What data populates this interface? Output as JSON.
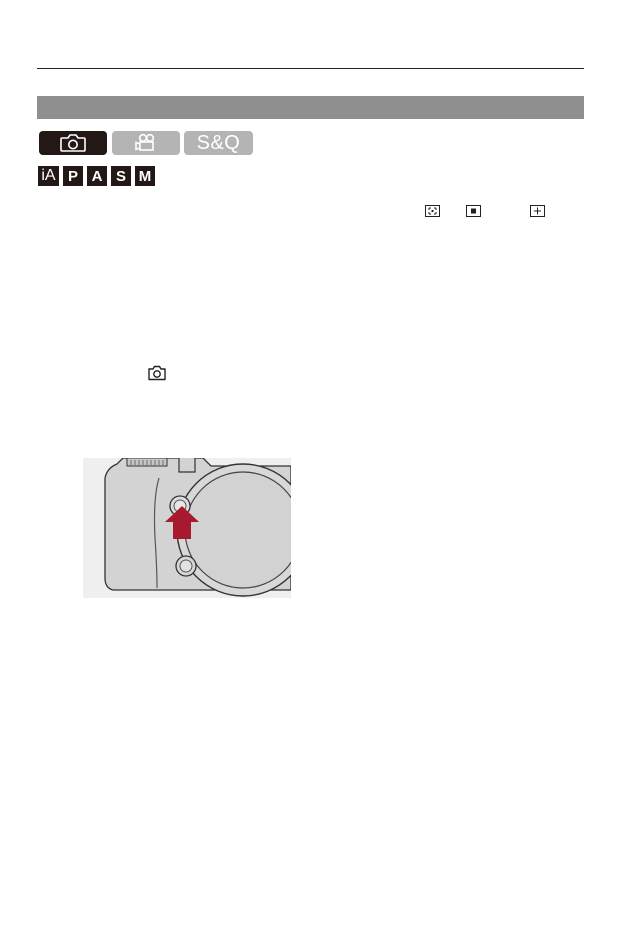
{
  "mode_tabs": [
    {
      "icon": "camera-icon",
      "label": ""
    },
    {
      "icon": "video-camera-icon",
      "label": ""
    },
    {
      "icon": "",
      "label": "S&Q"
    }
  ],
  "mode_badges": [
    "iA",
    "P",
    "A",
    "S",
    "M"
  ],
  "af_icons": [
    "af-area-icon",
    "af-pinpoint-icon",
    "af-cross-icon"
  ],
  "inline_icon": "camera-icon",
  "illustration": "camera-body-button-illustration",
  "colors": {
    "section_bar": "#8f8f8f",
    "tab_active": "#231815",
    "tab_inactive": "#b4b4b4",
    "arrow": "#a6192e"
  }
}
